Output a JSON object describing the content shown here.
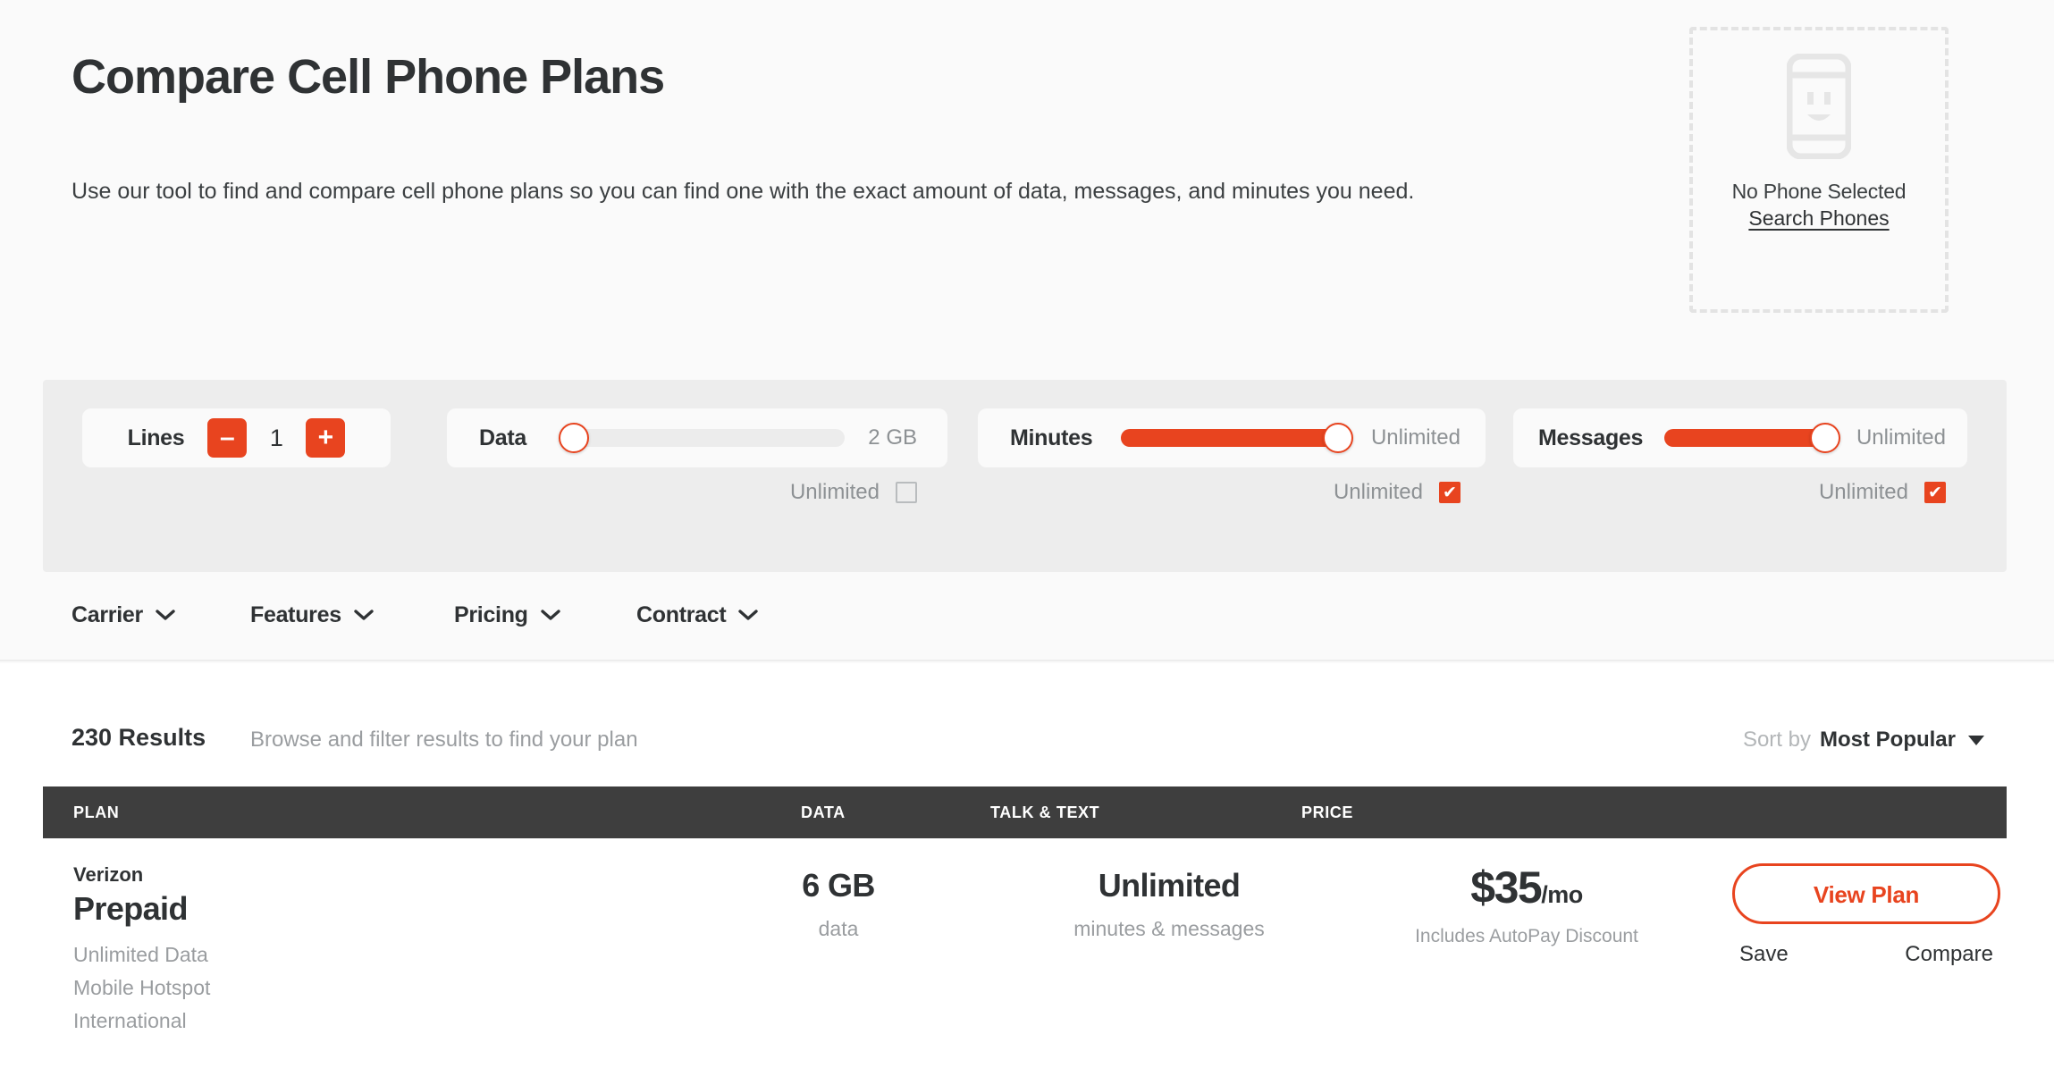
{
  "hero": {
    "title": "Compare Cell Phone Plans",
    "subtitle": "Use our tool to find and compare cell phone plans so you can find one with the exact amount of data, messages, and minutes you need.",
    "phone_selector": {
      "icon": "phone-smiley-icon",
      "status": "No Phone Selected",
      "link": "Search Phones"
    }
  },
  "filters": {
    "lines": {
      "label": "Lines",
      "decrement": "–",
      "increment": "+",
      "value": "1"
    },
    "data": {
      "label": "Data",
      "value": "2 GB",
      "slider_percent": 0,
      "unlimited_label": "Unlimited",
      "unlimited_checked": false
    },
    "minutes": {
      "label": "Minutes",
      "value": "Unlimited",
      "slider_percent": 100,
      "unlimited_label": "Unlimited",
      "unlimited_checked": true
    },
    "messages": {
      "label": "Messages",
      "value": "Unlimited",
      "slider_percent": 100,
      "unlimited_label": "Unlimited",
      "unlimited_checked": true
    }
  },
  "dropdowns": [
    {
      "label": "Carrier"
    },
    {
      "label": "Features"
    },
    {
      "label": "Pricing"
    },
    {
      "label": "Contract"
    }
  ],
  "results": {
    "count": "230 Results",
    "subtitle": "Browse and filter results to find your plan",
    "sort_by_label": "Sort by",
    "sort_value": "Most Popular",
    "columns": {
      "plan": "PLAN",
      "data": "DATA",
      "talk": "TALK & TEXT",
      "price": "PRICE"
    },
    "rows": [
      {
        "carrier": "Verizon",
        "name": "Prepaid",
        "features": "Unlimited Data\nMobile Hotspot\nInternational",
        "data_value": "6 GB",
        "data_unit": "data",
        "talk_value": "Unlimited",
        "talk_unit": "minutes & messages",
        "price_value": "$35",
        "price_period": "/mo",
        "price_note": "Includes AutoPay Discount",
        "view_plan": "View Plan",
        "save": "Save",
        "compare": "Compare"
      }
    ]
  },
  "colors": {
    "accent": "#e8441f",
    "dark": "#2f3234",
    "header_bar": "#3e3e3e",
    "panel": "#ededed",
    "muted": "#9a9da0"
  }
}
